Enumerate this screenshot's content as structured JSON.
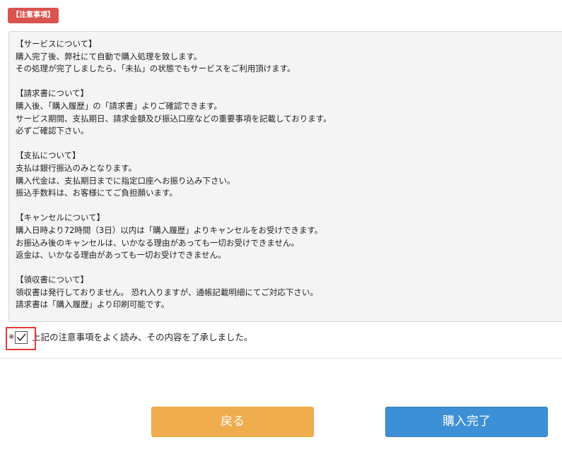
{
  "badge": "【注意事項】",
  "notice": {
    "sections": [
      {
        "lines": [
          "【サービスについて】",
          "購入完了後、弊社にて自動で購入処理を致します。",
          "その処理が完了しましたら、「未払」の状態でもサービスをご利用頂けます。"
        ]
      },
      {
        "lines": [
          "【請求書について】",
          "購入後、「購入履歴」の「請求書」よりご確認できます。",
          "サービス期間、支払期日、請求金額及び振込口座などの重要事項を記載しております。",
          "必ずご確認下さい。"
        ]
      },
      {
        "lines": [
          "【支払について】",
          "支払は銀行振込のみとなります。",
          "購入代金は、支払期日までに指定口座へお振り込み下さい。",
          "振込手数料は、お客様にてご負担願います。"
        ]
      },
      {
        "lines": [
          "【キャンセルについて】",
          "購入日時より72時間（3日）以内は「購入履歴」よりキャンセルをお受けできます。",
          "お振込み後のキャンセルは、いかなる理由があっても一切お受けできません。",
          "返金は、いかなる理由があっても一切お受けできません。"
        ]
      },
      {
        "lines": [
          "【領収書について】",
          "領収書は発行しておりません。 恐れ入りますが、通帳記載明細にてご対応下さい。",
          "請求書は「購入履歴」より印刷可能です。"
        ]
      }
    ]
  },
  "agreement": {
    "mark": "※",
    "text": "上記の注意事項をよく読み、その内容を了承しました。",
    "checked": true
  },
  "buttons": {
    "back": "戻る",
    "complete": "購入完了"
  },
  "colors": {
    "badge": "#d9534f",
    "back_button": "#f0ad4e",
    "complete_button": "#3d8fd6",
    "highlight": "#e53935"
  }
}
